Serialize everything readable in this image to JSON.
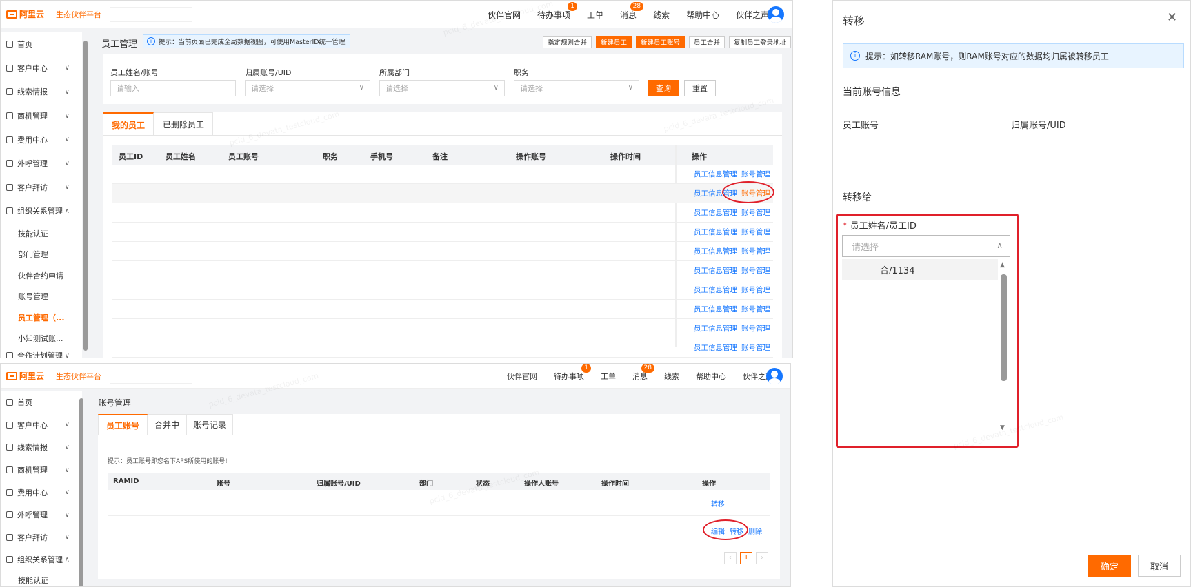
{
  "topbar": {
    "logo": "阿里云",
    "platform": "生态伙伴平台",
    "nav": [
      {
        "label": "伙伴官网",
        "badge": ""
      },
      {
        "label": "待办事项",
        "badge": "1"
      },
      {
        "label": "工单",
        "badge": ""
      },
      {
        "label": "消息",
        "badge": "28"
      },
      {
        "label": "线索",
        "badge": ""
      },
      {
        "label": "帮助中心",
        "badge": ""
      },
      {
        "label": "伙伴之声",
        "badge": ""
      }
    ]
  },
  "sidebar": {
    "top": [
      {
        "label": "首页",
        "icon": "home-icon"
      },
      {
        "label": "客户中心",
        "icon": "customer-icon"
      },
      {
        "label": "线索情报",
        "icon": "clue-icon"
      },
      {
        "label": "商机管理",
        "icon": "opportunity-icon"
      },
      {
        "label": "费用中心",
        "icon": "fee-icon"
      },
      {
        "label": "外呼管理",
        "icon": "phone-icon"
      },
      {
        "label": "客户拜访",
        "icon": "visit-icon"
      },
      {
        "label": "组织关系管理",
        "icon": "org-icon"
      }
    ],
    "org_sub": [
      "技能认证",
      "部门管理",
      "伙伴合约申请",
      "账号管理",
      "员工管理（...",
      "小知测试账..."
    ],
    "next_cut": "合作计划管理"
  },
  "panel1": {
    "title": "员工管理",
    "tip": "提示：当前页面已完成全局数据视图，可使用MasterID统一管理",
    "actions": [
      "指定规则合并",
      "新建员工",
      "新建员工账号",
      "员工合并",
      "复制员工登录地址"
    ],
    "filters": [
      {
        "label": "员工姓名/账号",
        "placeholder": "请输入"
      },
      {
        "label": "归属账号/UID",
        "placeholder": "请选择"
      },
      {
        "label": "所属部门",
        "placeholder": "请选择"
      },
      {
        "label": "职务",
        "placeholder": "请选择"
      }
    ],
    "query": "查询",
    "reset": "重置",
    "tabs": [
      "我的员工",
      "已删除员工"
    ],
    "columns": [
      "员工ID",
      "员工姓名",
      "员工账号",
      "职务",
      "手机号",
      "备注",
      "操作账号",
      "操作时间",
      "操作"
    ],
    "row_link1": "员工信息管理",
    "row_link2": "账号管理"
  },
  "panel2": {
    "title": "账号管理",
    "tabs": [
      "员工账号",
      "合并中",
      "账号记录"
    ],
    "tip": "提示：员工账号即您名下APS所使用的账号!",
    "columns": [
      "RAMID",
      "账号",
      "归属账号/UID",
      "部门",
      "状态",
      "操作人账号",
      "操作时间",
      "操作"
    ],
    "row1_op": "转移",
    "row2_ops": [
      "编辑",
      "转移",
      "删除"
    ],
    "page": "1"
  },
  "dialog": {
    "title": "转移",
    "tip": "提示：如转移RAM账号，则RAM账号对应的数据均归属被转移员工",
    "current_info": "当前账号信息",
    "staff_account": "员工账号",
    "owner_uid": "归属账号/UID",
    "transfer_to": "转移给",
    "field_label": "员工姓名/员工ID",
    "placeholder": "请选择",
    "option": "合/1134",
    "confirm": "确定",
    "cancel": "取消"
  },
  "watermark": "pcid_6_devata_testcloud_com",
  "colors": {
    "accent": "#ff6a00",
    "link": "#1677ff",
    "highlight": "#e0202a"
  }
}
